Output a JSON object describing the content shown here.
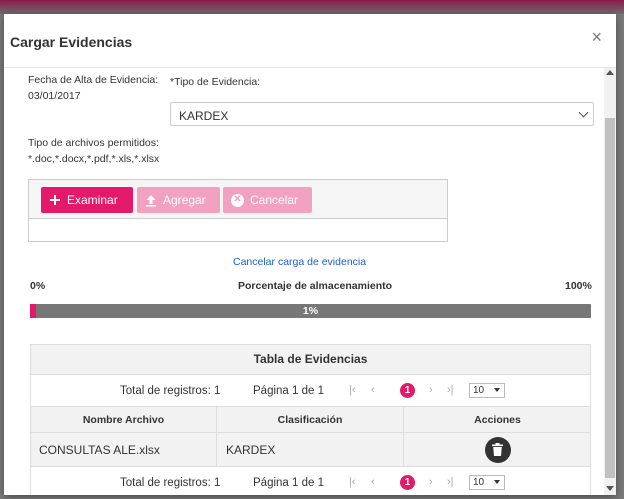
{
  "modal": {
    "title": "Cargar Evidencias",
    "close_label": "×"
  },
  "form": {
    "fecha_label": "Fecha de Alta de Evidencia:",
    "fecha_value": "03/01/2017",
    "tipo_label": "*Tipo de Evidencia:",
    "tipo_value": "KARDEX",
    "archivos_label": "Tipo de archivos permitidos:",
    "archivos_value": "*.doc,*.docx,*.pdf,*.xls,*.xlsx"
  },
  "upload": {
    "examinar": "Examinar",
    "agregar": "Agregar",
    "cancelar": "Cancelar",
    "cancel_link": "Cancelar carga de evidencia"
  },
  "storage": {
    "min": "0%",
    "label": "Porcentaje de almacenamiento",
    "max": "100%",
    "percent_text": "1%",
    "percent": 1
  },
  "table": {
    "title": "Tabla de Evidencias",
    "pager": {
      "total": "Total de registros: 1",
      "page": "Página 1 de 1",
      "current": "1",
      "page_size": "10"
    },
    "columns": [
      "Nombre Archivo",
      "Clasificación",
      "Acciones"
    ],
    "rows": [
      {
        "nombre": "CONSULTAS ALE.xlsx",
        "clasificacion": "KARDEX"
      }
    ]
  },
  "colors": {
    "accent": "#e5196a",
    "accent_disabled": "#f2a1c0",
    "bar": "#777777"
  }
}
